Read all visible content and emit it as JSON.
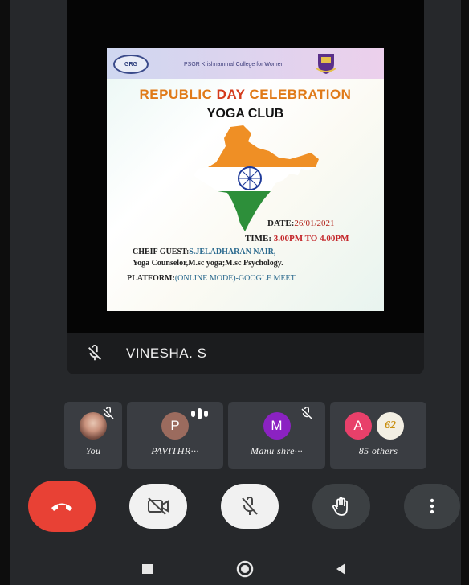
{
  "poster": {
    "college_name": "PSGR Krishnammal College for Women",
    "logo_text": "GRG",
    "title_word1": "REPUBLIC",
    "title_word2": "DAY",
    "title_word3": "CELEBRATION",
    "club": "YOGA CLUB",
    "date_label": "DATE:",
    "date_value": "26/01/2021",
    "time_label": "TIME:",
    "time_value": "3.00PM TO 4.00PM",
    "guest_label": "CHEIF GUEST:",
    "guest_value": "S.JELADHARAN NAIR,",
    "guest_role": "Yoga Counselor,M.sc yoga;M.sc Psychology.",
    "platform_label": "PLATFORM:",
    "platform_value": "(ONLINE MODE)-GOOGLE MEET"
  },
  "main_tile": {
    "participant_name": "VINESHA. S",
    "mic_icon": "mic-off-icon"
  },
  "participants": [
    {
      "name": "You",
      "avatar_type": "photo",
      "muted": true
    },
    {
      "name": "PAVITHR···",
      "initial": "P",
      "avatar_color": "#9b6b5e",
      "speaking": true
    },
    {
      "name": "Manu shre···",
      "initial": "M",
      "avatar_color": "#8b22c2",
      "muted": true
    },
    {
      "name": "85 others",
      "initial": "A",
      "avatar_color": "#e8406a",
      "second_avatar_text": "62"
    }
  ],
  "controls": {
    "end_call_color": "#e84135",
    "camera_icon": "video-off-icon",
    "mic_icon": "mic-off-icon",
    "hand_icon": "raise-hand-icon",
    "more_icon": "more-vertical-icon"
  },
  "navbar": {
    "recent_icon": "square-icon",
    "home_icon": "circle-icon",
    "back_icon": "triangle-back-icon"
  }
}
